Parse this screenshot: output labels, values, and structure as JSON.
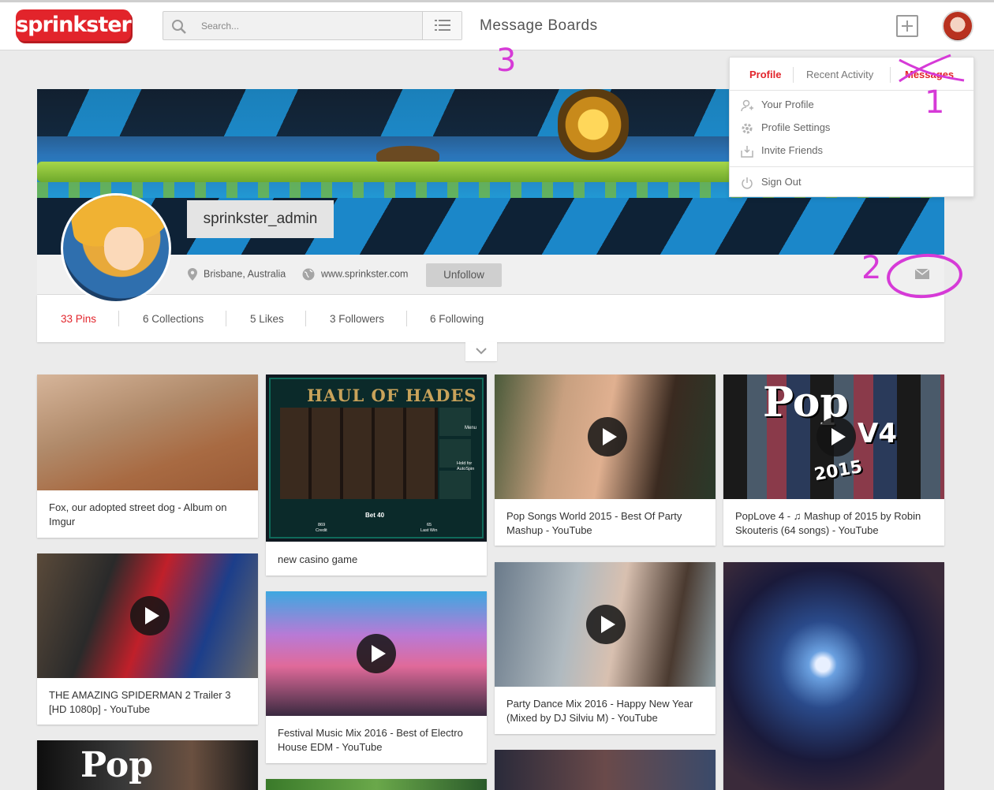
{
  "header": {
    "logo": "sprinkster",
    "search_placeholder": "Search...",
    "title": "Message Boards"
  },
  "profile": {
    "username": "sprinkster_admin",
    "location": "Brisbane, Australia",
    "website": "www.sprinkster.com",
    "unfollow_label": "Unfollow",
    "stats": [
      "33 Pins",
      "6 Collections",
      "5 Likes",
      "3 Followers",
      "6 Following"
    ]
  },
  "dropdown": {
    "tabs": [
      "Profile",
      "Recent Activity",
      "Messages"
    ],
    "items": [
      "Your Profile",
      "Profile Settings",
      "Invite Friends"
    ],
    "signout": "Sign Out"
  },
  "annotations": [
    "1",
    "2",
    "3"
  ],
  "pins": [
    {
      "caption": "Fox, our adopted street dog - Album on Imgur",
      "video": false
    },
    {
      "caption": "new casino game",
      "video": false,
      "game_title": "HAUL OF HADES",
      "menu": "Menu",
      "hold": "Hold for AutoSpin",
      "bet": "Bet 40",
      "credit_num": "869",
      "credit_label": "Credit",
      "lastwin_num": "65",
      "lastwin_label": "Last Win"
    },
    {
      "caption": "Pop Songs World 2015 - Best Of Party Mashup - YouTube",
      "video": true
    },
    {
      "caption": "PopLove 4 - ♫ Mashup of 2015 by Robin Skouteris (64 songs) - YouTube",
      "video": true,
      "art_text": "Pop",
      "art_v": "V4",
      "art_year": "2015"
    },
    {
      "caption": "THE AMAZING SPIDERMAN 2 Trailer 3 [HD 1080p] - YouTube",
      "video": true
    },
    {
      "caption": "Festival Music Mix 2016 - Best of Electro House EDM - YouTube",
      "video": true
    },
    {
      "caption": "Party Dance Mix 2016 - Happy New Year (Mixed by DJ Silviu M) - YouTube",
      "video": true
    },
    {
      "caption": "",
      "video": false
    },
    {
      "caption": "",
      "video": false,
      "art_text": "Pop"
    },
    {
      "caption": "",
      "video": false
    },
    {
      "caption": "",
      "video": false
    }
  ],
  "colors": {
    "brand": "#e2242b",
    "annotation": "#d63ad7"
  }
}
